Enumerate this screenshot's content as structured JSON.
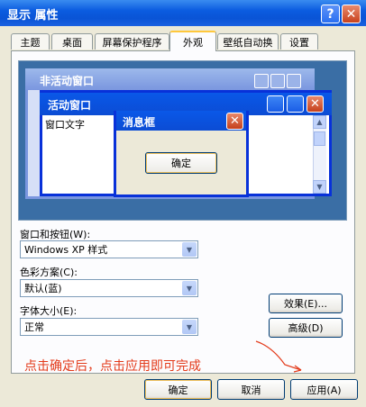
{
  "window": {
    "title": "显示 属性"
  },
  "title_buttons": {
    "help": "?",
    "close": "✕"
  },
  "tabs": [
    {
      "label": "主题"
    },
    {
      "label": "桌面"
    },
    {
      "label": "屏幕保护程序"
    },
    {
      "label": "外观"
    },
    {
      "label": "壁纸自动换"
    },
    {
      "label": "设置"
    }
  ],
  "active_tab": "外观",
  "preview": {
    "inactive_window_title": "非活动窗口",
    "active_window_title": "活动窗口",
    "window_text": "窗口文字",
    "message_box_title": "消息框",
    "message_box_ok": "确定"
  },
  "form": {
    "windows_buttons_label": "窗口和按钮(W):",
    "windows_buttons_value": "Windows XP 样式",
    "color_scheme_label": "色彩方案(C):",
    "color_scheme_value": "默认(蓝)",
    "font_size_label": "字体大小(E):",
    "font_size_value": "正常",
    "effects_button": "效果(E)...",
    "advanced_button": "高级(D)"
  },
  "annotation": "点击确定后，点击应用即可完成",
  "footer": {
    "ok": "确定",
    "cancel": "取消",
    "apply": "应用(A)"
  },
  "colors": {
    "annotation": "#e33a1a",
    "title_bar": "#0a54d6",
    "dialog_bg": "#ece9d8"
  }
}
